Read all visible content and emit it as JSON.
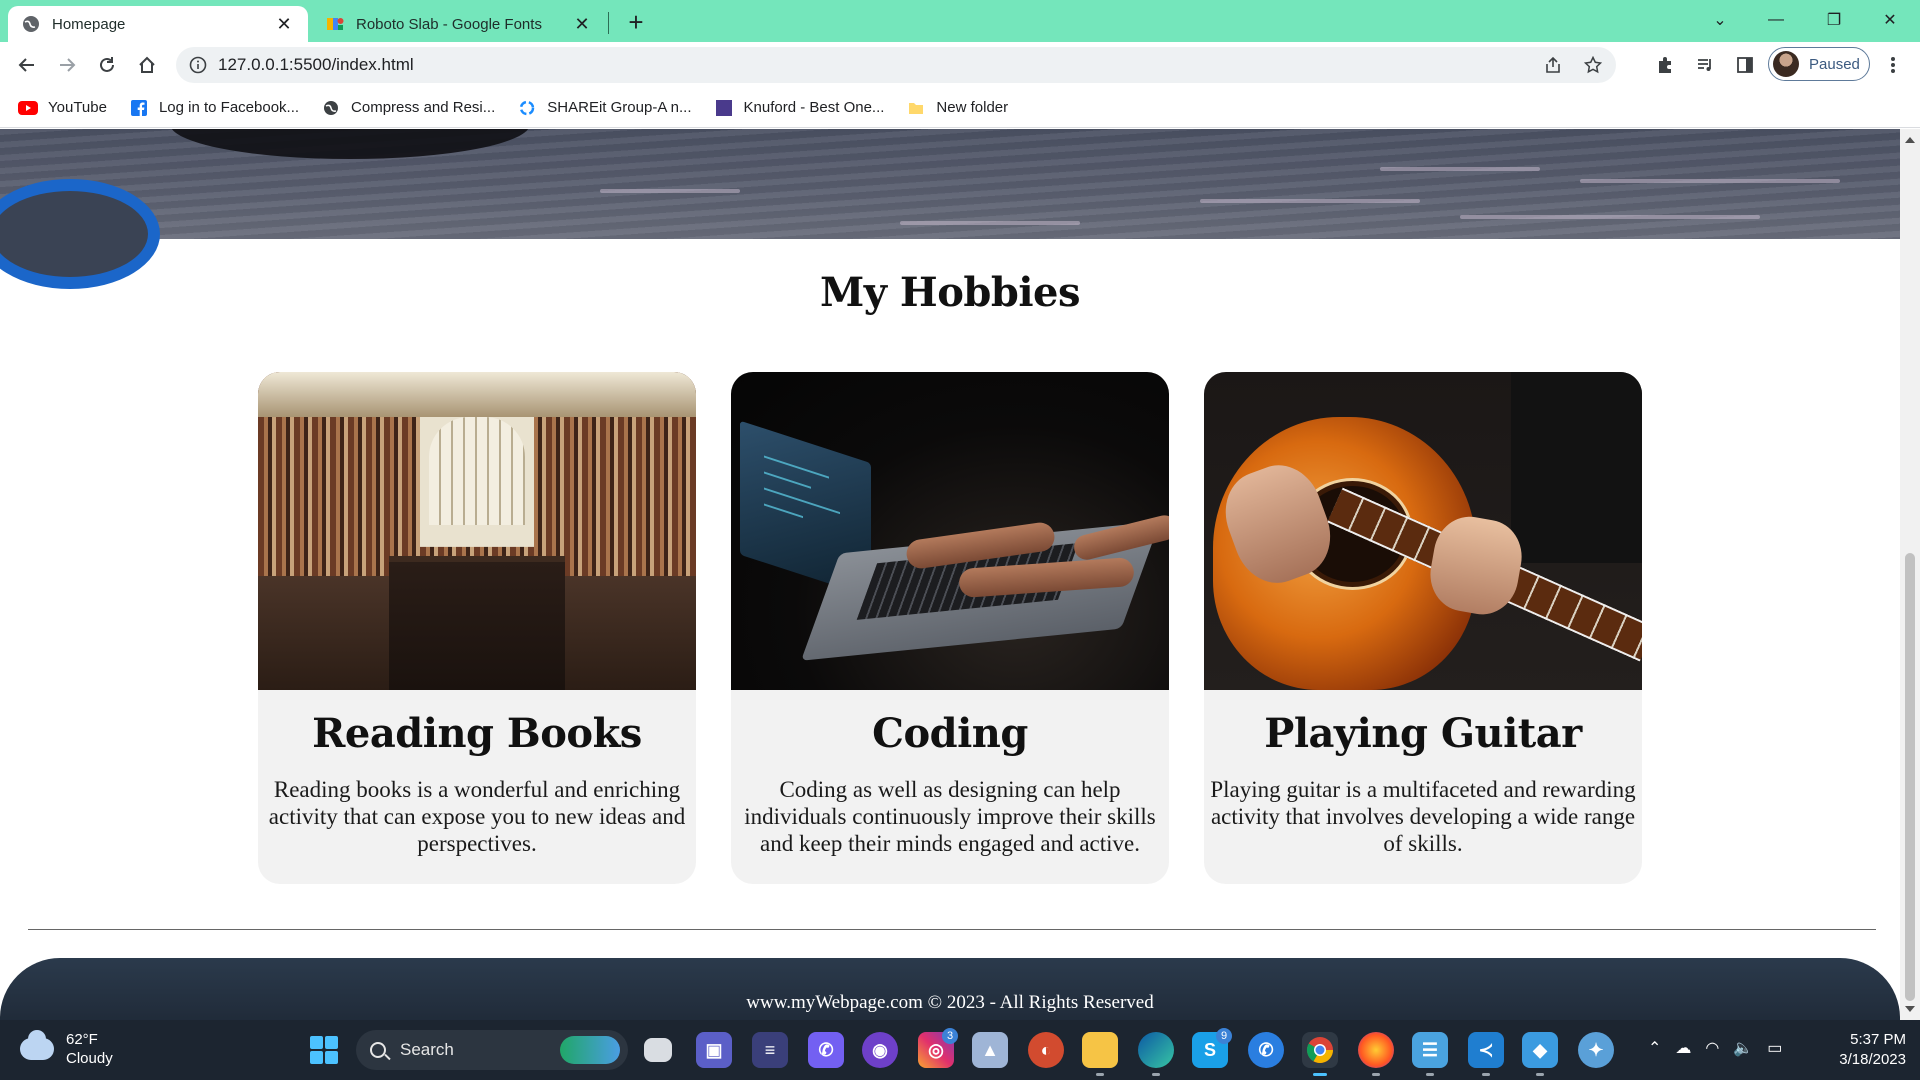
{
  "browser": {
    "tabs": [
      {
        "title": "Homepage",
        "active": true
      },
      {
        "title": "Roboto Slab - Google Fonts",
        "active": false
      }
    ],
    "url": "127.0.0.1:5500/index.html",
    "profile_label": "Paused",
    "bookmarks": [
      {
        "label": "YouTube",
        "icon": "youtube-icon"
      },
      {
        "label": "Log in to Facebook...",
        "icon": "facebook-icon"
      },
      {
        "label": "Compress and Resi...",
        "icon": "globe-icon"
      },
      {
        "label": "SHAREit Group-A n...",
        "icon": "shareit-icon"
      },
      {
        "label": "Knuford - Best One...",
        "icon": "knuford-icon"
      },
      {
        "label": "New folder",
        "icon": "folder-icon"
      }
    ]
  },
  "page": {
    "section_title": "My Hobbies",
    "cards": [
      {
        "title": "Reading Books",
        "description": "Reading books is a wonderful and enriching activity that can expose you to new ideas and perspectives.",
        "image": "library-photo"
      },
      {
        "title": "Coding",
        "description": "Coding as well as designing can help individuals continuously improve their skills and keep their minds engaged and active.",
        "image": "laptop-typing-photo"
      },
      {
        "title": "Playing Guitar",
        "description": "Playing guitar is a multifaceted and rewarding activity that involves developing a wide range of skills.",
        "image": "acoustic-guitar-photo"
      }
    ],
    "footer_text": "www.myWebpage.com © 2023 - All Rights Reserved"
  },
  "taskbar": {
    "weather_temp": "62°F",
    "weather_desc": "Cloudy",
    "search_label": "Search",
    "apps": [
      {
        "name": "file-explorer-icon",
        "badge": ""
      },
      {
        "name": "teams-icon",
        "badge": ""
      },
      {
        "name": "app-icon",
        "badge": ""
      },
      {
        "name": "viber-icon",
        "badge": ""
      },
      {
        "name": "github-icon",
        "badge": ""
      },
      {
        "name": "instagram-icon",
        "badge": "3"
      },
      {
        "name": "photos-icon",
        "badge": ""
      },
      {
        "name": "app-icon",
        "badge": ""
      },
      {
        "name": "folder-icon",
        "badge": ""
      },
      {
        "name": "edge-icon",
        "badge": ""
      },
      {
        "name": "skype-icon",
        "badge": "9"
      },
      {
        "name": "phone-icon",
        "badge": ""
      },
      {
        "name": "chrome-icon",
        "badge": ""
      },
      {
        "name": "firefox-icon",
        "badge": ""
      },
      {
        "name": "notepad-icon",
        "badge": ""
      },
      {
        "name": "vscode-icon",
        "badge": ""
      },
      {
        "name": "paint-icon",
        "badge": ""
      },
      {
        "name": "app-icon",
        "badge": ""
      }
    ],
    "time": "5:37 PM",
    "date": "3/18/2023"
  },
  "colors": {
    "tab_strip": "#74e6bb",
    "footer": "#1d2734",
    "card_bg": "#f2f2f2"
  }
}
